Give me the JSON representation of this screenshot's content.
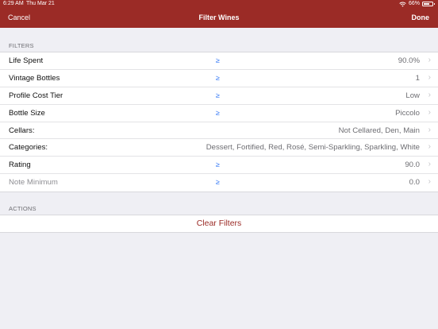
{
  "status_bar": {
    "time": "6:29 AM",
    "date": "Thu Mar 21",
    "battery": "66%",
    "battery_level": 0.66
  },
  "navbar": {
    "cancel_label": "Cancel",
    "title": "Filter Wines",
    "done_label": "Done"
  },
  "filters": {
    "header": "FILTERS",
    "rows": [
      {
        "label": "Life Spent",
        "op": "≥",
        "value": "90.0%"
      },
      {
        "label": "Vintage Bottles",
        "op": "≥",
        "value": "1"
      },
      {
        "label": "Profile Cost Tier",
        "op": "≥",
        "value": "Low"
      },
      {
        "label": "Bottle Size",
        "op": "≥",
        "value": "Piccolo"
      },
      {
        "label": "Cellars:",
        "op": "",
        "value": "Not Cellared, Den, Main"
      },
      {
        "label": "Categories:",
        "op": "",
        "value": "Dessert, Fortified, Red, Rosé, Semi-Sparkling, Sparkling, White"
      },
      {
        "label": "Rating",
        "op": "≥",
        "value": "90.0"
      },
      {
        "label": "Note Minimum",
        "op": "≥",
        "value": "0.0"
      }
    ]
  },
  "actions": {
    "header": "ACTIONS",
    "clear_label": "Clear Filters"
  },
  "colors": {
    "brand": "#9b2b26",
    "operator": "#3478f6",
    "background": "#efeff4"
  }
}
